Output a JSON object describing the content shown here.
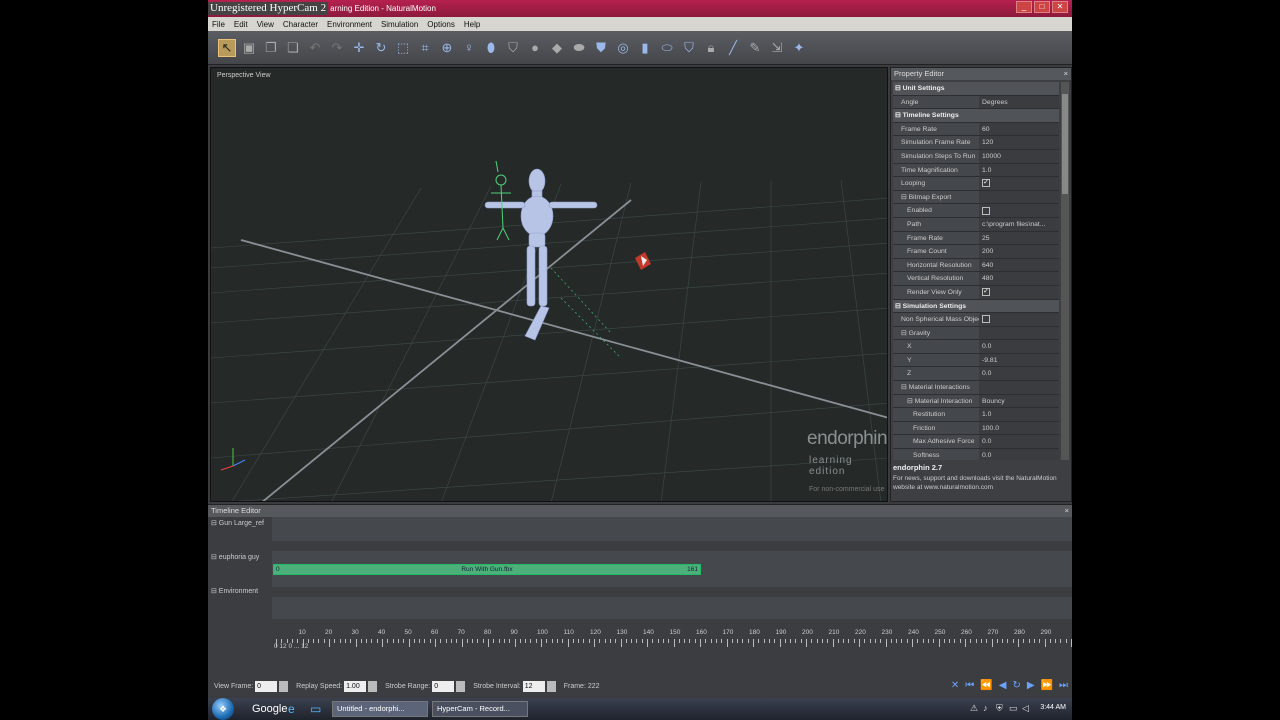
{
  "window": {
    "watermark": "Unregistered HyperCam 2",
    "title": "arning Edition - NaturalMotion",
    "buttons": [
      "_",
      "□",
      "✕"
    ]
  },
  "menu": [
    "File",
    "Edit",
    "View",
    "Character",
    "Environment",
    "Simulation",
    "Options",
    "Help"
  ],
  "viewport": {
    "label": "Perspective View",
    "logo": "endorphin",
    "logo_sub": "learning edition",
    "logo_note": "For non-commercial use"
  },
  "property_editor": {
    "title": "Property Editor",
    "close": "×",
    "rows": [
      {
        "k": "⊟ Unit Settings",
        "v": "",
        "sec": true
      },
      {
        "k": "Angle",
        "v": "Degrees",
        "ind": 1
      },
      {
        "k": "⊟ Timeline Settings",
        "v": "",
        "sec": true
      },
      {
        "k": "Frame Rate",
        "v": "60",
        "ind": 1
      },
      {
        "k": "Simulation Frame Rate",
        "v": "120",
        "ind": 1
      },
      {
        "k": "Simulation Steps To Run",
        "v": "10000",
        "ind": 1
      },
      {
        "k": "Time Magnification",
        "v": "1.0",
        "ind": 1
      },
      {
        "k": "Looping",
        "v": "",
        "chk": true,
        "ind": 1
      },
      {
        "k": "⊟ Bitmap Export",
        "v": "",
        "ind": 1
      },
      {
        "k": "Enabled",
        "v": "",
        "chk": false,
        "ind": 2
      },
      {
        "k": "Path",
        "v": "c:\\program files\\nat...",
        "ind": 2
      },
      {
        "k": "Frame Rate",
        "v": "25",
        "ind": 2
      },
      {
        "k": "Frame Count",
        "v": "200",
        "ind": 2
      },
      {
        "k": "Horizontal Resolution",
        "v": "640",
        "ind": 2
      },
      {
        "k": "Vertical Resolution",
        "v": "480",
        "ind": 2
      },
      {
        "k": "Render View Only",
        "v": "",
        "chk": true,
        "ind": 2
      },
      {
        "k": "⊟ Simulation Settings",
        "v": "",
        "sec": true
      },
      {
        "k": "Non Spherical Mass Objects",
        "v": "",
        "chk": false,
        "ind": 1
      },
      {
        "k": "⊟ Gravity",
        "v": "",
        "ind": 1
      },
      {
        "k": "X",
        "v": "0.0",
        "ind": 2
      },
      {
        "k": "Y",
        "v": "-9.81",
        "ind": 2
      },
      {
        "k": "Z",
        "v": "0.0",
        "ind": 2
      },
      {
        "k": "⊟ Material Interactions",
        "v": "",
        "ind": 1
      },
      {
        "k": "⊟ Material Interaction",
        "v": "Bouncy",
        "ind": 2
      },
      {
        "k": "Restitution",
        "v": "1.0",
        "ind": 3
      },
      {
        "k": "Friction",
        "v": "100.0",
        "ind": 3
      },
      {
        "k": "Max Adhesive Force",
        "v": "0.0",
        "ind": 3
      },
      {
        "k": "Softness",
        "v": "0.0",
        "ind": 3
      }
    ],
    "info_title": "endorphin 2.7",
    "info_text": "For news, support and downloads visit the NaturalMotion website at www.naturalmotion.com"
  },
  "timeline": {
    "title": "Timeline Editor",
    "close": "×",
    "tracks": [
      "⊟ Gun Large_ref",
      "⊟ euphoria guy",
      "⊟ Environment"
    ],
    "clip": {
      "label": "Run With Gun.fbx",
      "start": "0",
      "end": "161"
    },
    "ruler": [
      "10",
      "20",
      "30",
      "40",
      "50",
      "60",
      "70",
      "80",
      "90",
      "100",
      "110",
      "120",
      "130",
      "140",
      "150",
      "160",
      "170",
      "180",
      "190",
      "200",
      "210",
      "220",
      "230",
      "240",
      "250",
      "260",
      "270",
      "280",
      "290"
    ],
    "ruler_under": [
      "0",
      "12",
      "0",
      "... 12"
    ]
  },
  "bottombar": {
    "view_frame_label": "View Frame:",
    "view_frame": "0",
    "replay_label": "Replay Speed:",
    "replay": "1.00",
    "strobe_range_label": "Strobe Range:",
    "strobe_range": "0",
    "strobe_interval_label": "Strobe Interval:",
    "strobe_interval": "12",
    "frame_label": "Frame: 222"
  },
  "taskbar": {
    "google": "Google",
    "tasks": [
      "Untitled - endorphi...",
      "HyperCam - Record..."
    ],
    "clock": "3:44 AM"
  }
}
